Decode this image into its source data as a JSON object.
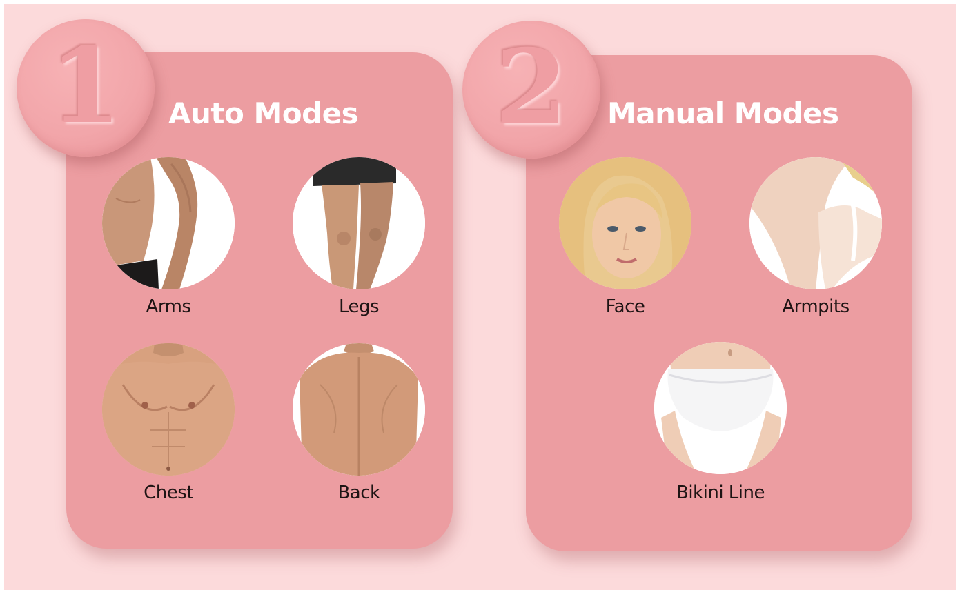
{
  "modes": [
    {
      "number": "1",
      "title": "Auto Modes",
      "areas": [
        {
          "label": "Arms",
          "icon": "arms-photo"
        },
        {
          "label": "Legs",
          "icon": "legs-photo"
        },
        {
          "label": "Chest",
          "icon": "chest-photo"
        },
        {
          "label": "Back",
          "icon": "back-photo"
        }
      ]
    },
    {
      "number": "2",
      "title": "Manual Modes",
      "areas": [
        {
          "label": "Face",
          "icon": "face-photo"
        },
        {
          "label": "Armpits",
          "icon": "armpits-photo"
        },
        {
          "label": "Bikini Line",
          "icon": "bikini-line-photo"
        }
      ]
    }
  ],
  "colors": {
    "background": "#fcdadb",
    "card": "#ec9da1",
    "badge": "#f2a6aa",
    "title_text": "#ffffff",
    "label_text": "#1e1414"
  }
}
